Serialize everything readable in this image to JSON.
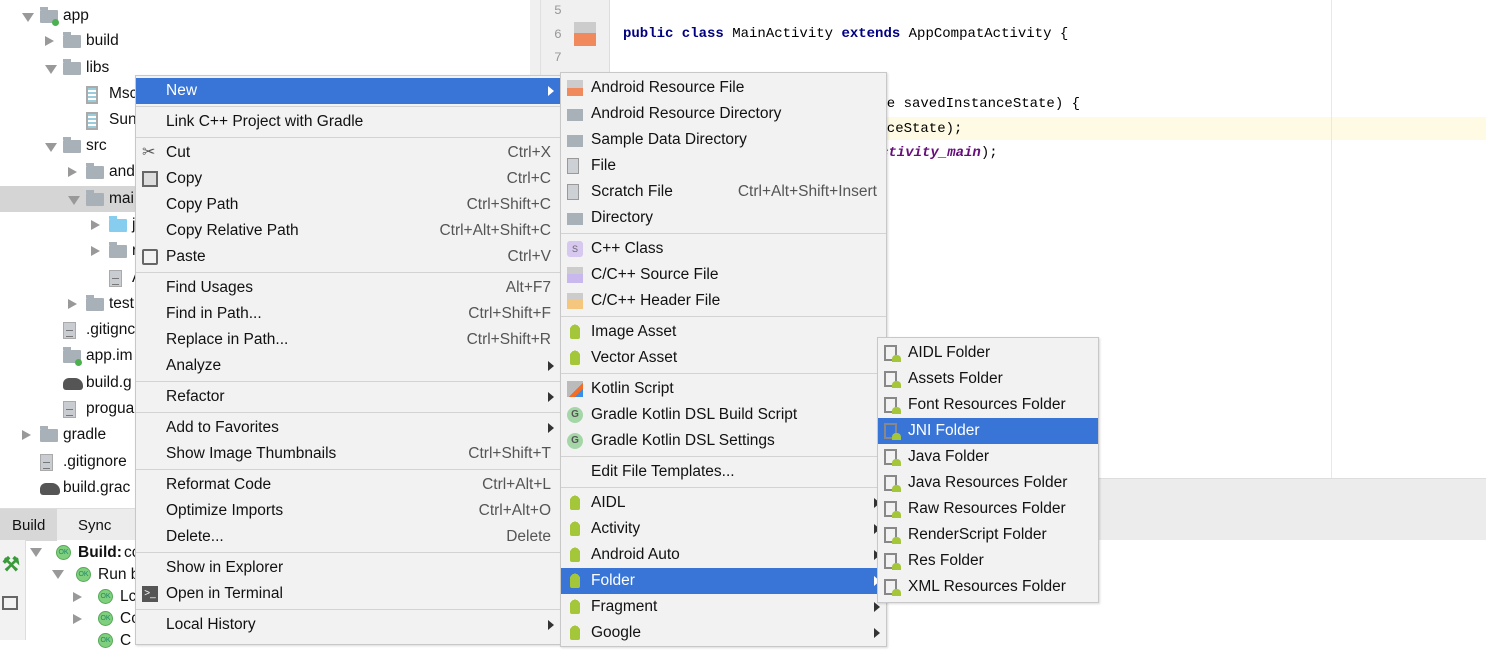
{
  "project_tree": [
    {
      "label": "app",
      "depth": 0,
      "arrow": "down",
      "icon": "module-folder-icon"
    },
    {
      "label": "build",
      "depth": 1,
      "arrow": "right",
      "icon": "folder-icon"
    },
    {
      "label": "libs",
      "depth": 1,
      "arrow": "down",
      "icon": "folder-icon"
    },
    {
      "label": "Msc",
      "depth": 2,
      "arrow": "",
      "icon": "jar-icon"
    },
    {
      "label": "Sun",
      "depth": 2,
      "arrow": "",
      "icon": "jar-icon"
    },
    {
      "label": "src",
      "depth": 1,
      "arrow": "down",
      "icon": "folder-icon"
    },
    {
      "label": "and",
      "depth": 2,
      "arrow": "right",
      "icon": "folder-icon"
    },
    {
      "label": "mai",
      "depth": 2,
      "arrow": "down",
      "icon": "folder-icon",
      "selected": true
    },
    {
      "label": "j",
      "depth": 3,
      "arrow": "right",
      "icon": "source-folder-icon"
    },
    {
      "label": "r",
      "depth": 3,
      "arrow": "right",
      "icon": "resource-folder-icon"
    },
    {
      "label": "A",
      "depth": 3,
      "arrow": "",
      "icon": "manifest-icon"
    },
    {
      "label": "test",
      "depth": 2,
      "arrow": "right",
      "icon": "folder-icon"
    },
    {
      "label": ".gitignc",
      "depth": 1,
      "arrow": "",
      "icon": "text-file-icon"
    },
    {
      "label": "app.im",
      "depth": 1,
      "arrow": "",
      "icon": "module-file-icon"
    },
    {
      "label": "build.g",
      "depth": 1,
      "arrow": "",
      "icon": "gradle-icon"
    },
    {
      "label": "progua",
      "depth": 1,
      "arrow": "",
      "icon": "text-file-icon"
    },
    {
      "label": "gradle",
      "depth": 0,
      "arrow": "right",
      "icon": "folder-icon"
    },
    {
      "label": ".gitignore",
      "depth": 0,
      "arrow": "",
      "icon": "text-file-icon",
      "flat": true
    },
    {
      "label": "build.grac",
      "depth": 0,
      "arrow": "",
      "icon": "gradle-icon",
      "flat": true
    }
  ],
  "editor": {
    "line_numbers": [
      "5",
      "6",
      "7"
    ],
    "line6": {
      "kw1": "public class ",
      "name": "MainActivity ",
      "kw2": "extends ",
      "rest": "AppCompatActivity {"
    },
    "line_a": "dle savedInstanceState) {",
    "line_b": "anceState);",
    "line_c_italic": "ctivity_main",
    "line_c_end": ");"
  },
  "bottom_panel": {
    "tabs": [
      "Build",
      "Sync"
    ],
    "rows": [
      {
        "label": "Build:",
        "extra": "cc",
        "bold": true
      },
      {
        "label": "Run b"
      },
      {
        "label": "Lc"
      },
      {
        "label": "Cc"
      },
      {
        "label": "C"
      }
    ],
    "ok_badge": "OK"
  },
  "context_menu": [
    {
      "label": "New",
      "submenu": true,
      "highlighted": true
    },
    {
      "sep": true
    },
    {
      "label": "Link C++ Project with Gradle"
    },
    {
      "sep": true
    },
    {
      "label": "Cut",
      "shortcut": "Ctrl+X",
      "icon": "scissors-icon"
    },
    {
      "label": "Copy",
      "shortcut": "Ctrl+C",
      "icon": "copy-icon"
    },
    {
      "label": "Copy Path",
      "shortcut": "Ctrl+Shift+C"
    },
    {
      "label": "Copy Relative Path",
      "shortcut": "Ctrl+Alt+Shift+C"
    },
    {
      "label": "Paste",
      "shortcut": "Ctrl+V",
      "icon": "paste-icon"
    },
    {
      "sep": true
    },
    {
      "label": "Find Usages",
      "shortcut": "Alt+F7"
    },
    {
      "label": "Find in Path...",
      "shortcut": "Ctrl+Shift+F"
    },
    {
      "label": "Replace in Path...",
      "shortcut": "Ctrl+Shift+R"
    },
    {
      "label": "Analyze",
      "submenu": true
    },
    {
      "sep": true
    },
    {
      "label": "Refactor",
      "submenu": true
    },
    {
      "sep": true
    },
    {
      "label": "Add to Favorites",
      "submenu": true
    },
    {
      "label": "Show Image Thumbnails",
      "shortcut": "Ctrl+Shift+T"
    },
    {
      "sep": true
    },
    {
      "label": "Reformat Code",
      "shortcut": "Ctrl+Alt+L"
    },
    {
      "label": "Optimize Imports",
      "shortcut": "Ctrl+Alt+O"
    },
    {
      "label": "Delete...",
      "shortcut": "Delete"
    },
    {
      "sep": true
    },
    {
      "label": "Show in Explorer"
    },
    {
      "label": "Open in Terminal",
      "icon": "terminal-icon"
    },
    {
      "sep": true
    },
    {
      "label": "Local History",
      "submenu": true
    }
  ],
  "new_submenu": [
    {
      "label": "Android Resource File",
      "icon": "android-resource-file-icon"
    },
    {
      "label": "Android Resource Directory",
      "icon": "folder-icon"
    },
    {
      "label": "Sample Data Directory",
      "icon": "folder-icon"
    },
    {
      "label": "File",
      "icon": "file-icon"
    },
    {
      "label": "Scratch File",
      "shortcut": "Ctrl+Alt+Shift+Insert",
      "icon": "scratch-file-icon"
    },
    {
      "label": "Directory",
      "icon": "folder-icon"
    },
    {
      "sep": true
    },
    {
      "label": "C++ Class",
      "icon": "cpp-class-icon"
    },
    {
      "label": "C/C++ Source File",
      "icon": "cpp-source-icon"
    },
    {
      "label": "C/C++ Header File",
      "icon": "cpp-header-icon"
    },
    {
      "sep": true
    },
    {
      "label": "Image Asset",
      "icon": "android-icon"
    },
    {
      "label": "Vector Asset",
      "icon": "android-icon"
    },
    {
      "sep": true
    },
    {
      "label": "Kotlin Script",
      "icon": "kotlin-icon"
    },
    {
      "label": "Gradle Kotlin DSL Build Script",
      "icon": "gradle-g-icon"
    },
    {
      "label": "Gradle Kotlin DSL Settings",
      "icon": "gradle-g-icon"
    },
    {
      "sep": true
    },
    {
      "label": "Edit File Templates..."
    },
    {
      "sep": true
    },
    {
      "label": "AIDL",
      "submenu": true,
      "icon": "android-icon"
    },
    {
      "label": "Activity",
      "submenu": true,
      "icon": "android-icon"
    },
    {
      "label": "Android Auto",
      "submenu": true,
      "icon": "android-icon"
    },
    {
      "label": "Folder",
      "submenu": true,
      "icon": "android-icon",
      "highlighted": true
    },
    {
      "label": "Fragment",
      "submenu": true,
      "icon": "android-icon"
    },
    {
      "label": "Google",
      "submenu": true,
      "icon": "android-icon"
    }
  ],
  "folder_submenu": [
    {
      "label": "AIDL Folder"
    },
    {
      "label": "Assets Folder"
    },
    {
      "label": "Font Resources Folder"
    },
    {
      "label": "JNI Folder",
      "highlighted": true
    },
    {
      "label": "Java Folder"
    },
    {
      "label": "Java Resources Folder"
    },
    {
      "label": "Raw Resources Folder"
    },
    {
      "label": "RenderScript Folder"
    },
    {
      "label": "Res Folder"
    },
    {
      "label": "XML Resources Folder"
    }
  ],
  "colors": {
    "highlight": "#3875d7",
    "menu_bg": "#f2f2f2",
    "android_green": "#a4c639",
    "current_line": "#fffae3"
  }
}
